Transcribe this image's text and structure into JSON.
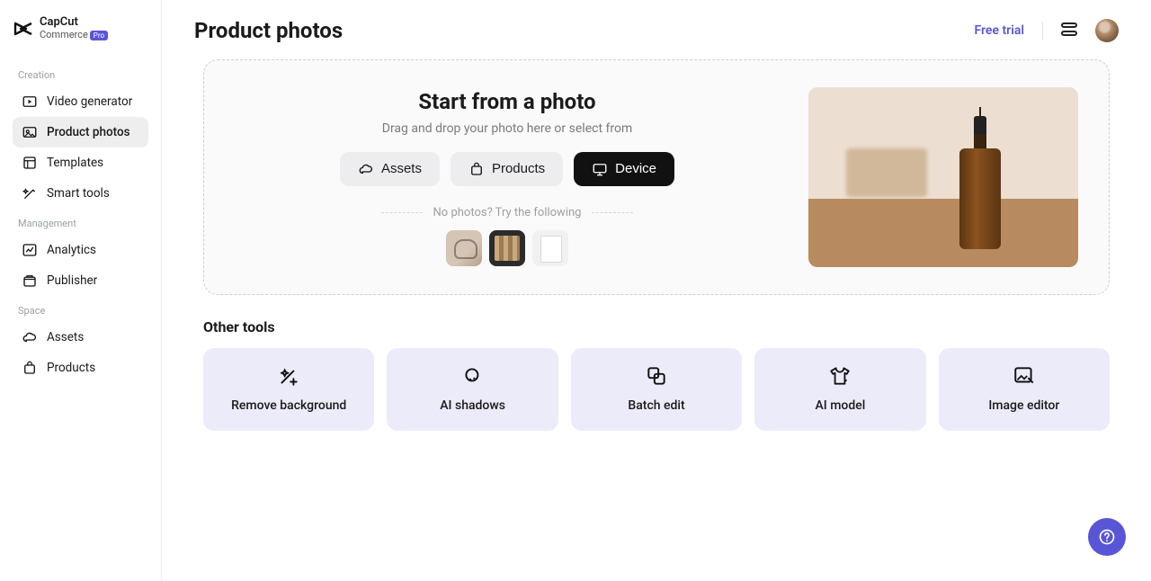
{
  "brand": {
    "name": "CapCut",
    "sub": "Commerce",
    "badge": "Pro"
  },
  "sidebar": {
    "groups": [
      {
        "label": "Creation",
        "items": [
          {
            "id": "video-generator",
            "label": "Video generator"
          },
          {
            "id": "product-photos",
            "label": "Product photos"
          },
          {
            "id": "templates",
            "label": "Templates"
          },
          {
            "id": "smart-tools",
            "label": "Smart tools"
          }
        ]
      },
      {
        "label": "Management",
        "items": [
          {
            "id": "analytics",
            "label": "Analytics"
          },
          {
            "id": "publisher",
            "label": "Publisher"
          }
        ]
      },
      {
        "label": "Space",
        "items": [
          {
            "id": "assets",
            "label": "Assets"
          },
          {
            "id": "products",
            "label": "Products"
          }
        ]
      }
    ]
  },
  "header": {
    "title": "Product photos",
    "free_trial": "Free trial"
  },
  "upload": {
    "title": "Start from a photo",
    "sub": "Drag and drop your photo here or select from",
    "sources": {
      "assets": "Assets",
      "products": "Products",
      "device": "Device"
    },
    "nophotos": "No photos? Try the following"
  },
  "other_tools": {
    "title": "Other tools",
    "items": [
      {
        "id": "remove-bg",
        "label": "Remove background"
      },
      {
        "id": "ai-shadows",
        "label": "AI shadows"
      },
      {
        "id": "batch-edit",
        "label": "Batch edit"
      },
      {
        "id": "ai-model",
        "label": "AI model"
      },
      {
        "id": "image-editor",
        "label": "Image editor"
      }
    ]
  }
}
